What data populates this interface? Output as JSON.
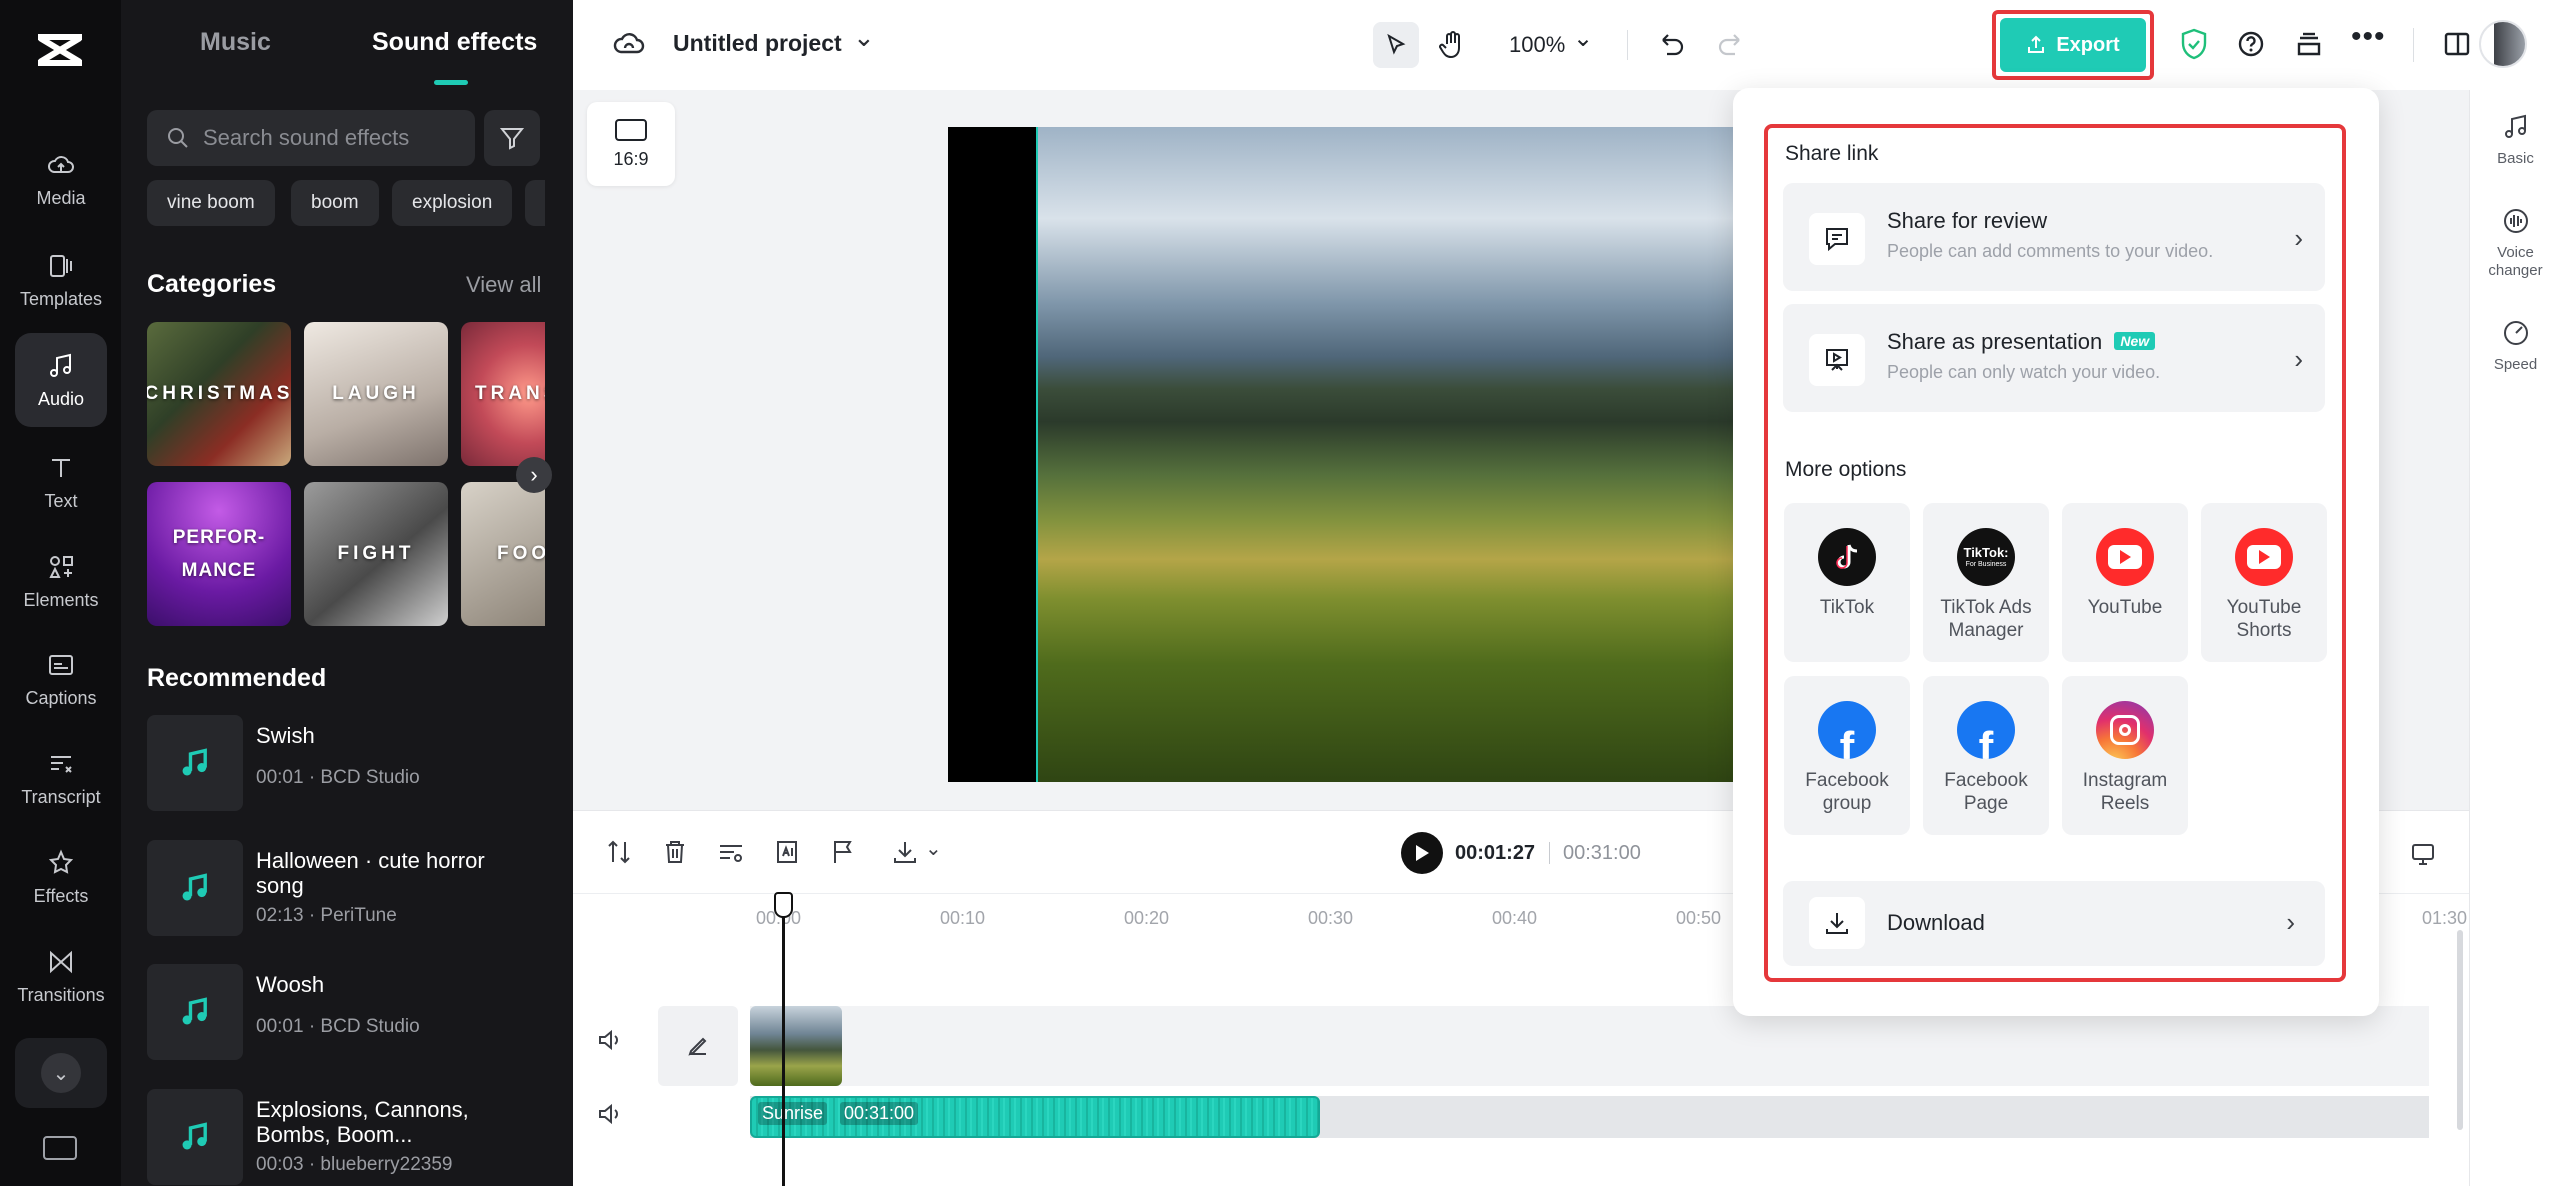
{
  "rail": {
    "items": [
      {
        "label": "Media",
        "icon": "cloud-icon"
      },
      {
        "label": "Templates",
        "icon": "templates-icon"
      },
      {
        "label": "Audio",
        "icon": "music-note-icon"
      },
      {
        "label": "Text",
        "icon": "text-icon"
      },
      {
        "label": "Elements",
        "icon": "elements-icon"
      },
      {
        "label": "Captions",
        "icon": "captions-icon"
      },
      {
        "label": "Transcript",
        "icon": "transcript-icon"
      },
      {
        "label": "Effects",
        "icon": "effects-icon"
      },
      {
        "label": "Transitions",
        "icon": "transitions-icon"
      }
    ]
  },
  "panel": {
    "tabs": [
      "Music",
      "Sound effects"
    ],
    "search_placeholder": "Search sound effects",
    "chips": [
      "vine boom",
      "boom",
      "explosion"
    ],
    "categories_title": "Categories",
    "view_all": "View all",
    "categories": [
      "CHRISTMAS",
      "LAUGH",
      "TRANSI",
      "PERFOR-\nMANCE",
      "FIGHT",
      "FOO"
    ],
    "recommended_title": "Recommended",
    "recommended": [
      {
        "title": "Swish",
        "meta": "00:01 · BCD Studio"
      },
      {
        "title": "Halloween · cute horror song",
        "meta": "02:13 · PeriTune"
      },
      {
        "title": "Woosh",
        "meta": "00:01 · BCD Studio"
      },
      {
        "title": "Explosions, Cannons, Bombs, Boom...",
        "meta": "00:03 · blueberry22359"
      }
    ]
  },
  "topbar": {
    "project_name": "Untitled project",
    "zoom": "100%",
    "export_label": "Export"
  },
  "stage": {
    "aspect": "16:9"
  },
  "popup": {
    "share_link_title": "Share link",
    "share_review": {
      "title": "Share for review",
      "subtitle": "People can add comments to your video."
    },
    "share_presentation": {
      "title": "Share as presentation",
      "badge": "New",
      "subtitle": "People can only watch your video."
    },
    "more_options_title": "More options",
    "options": [
      {
        "label": "TikTok",
        "icon": "tiktok-icon"
      },
      {
        "label": "TikTok Ads Manager",
        "icon": "tiktok-business-icon"
      },
      {
        "label": "YouTube",
        "icon": "youtube-icon"
      },
      {
        "label": "YouTube Shorts",
        "icon": "youtube-icon"
      },
      {
        "label": "Facebook group",
        "icon": "facebook-icon"
      },
      {
        "label": "Facebook Page",
        "icon": "facebook-icon"
      },
      {
        "label": "Instagram Reels",
        "icon": "instagram-icon"
      }
    ],
    "tiktok_business_text": "TikTok:",
    "tiktok_business_sub": "For Business",
    "download_label": "Download"
  },
  "player": {
    "current_time": "00:01:27",
    "total_time": "00:31:00"
  },
  "timeline": {
    "ruler": [
      "00:00",
      "00:10",
      "00:20",
      "00:30",
      "00:40",
      "00:50",
      "01:30"
    ],
    "audio_clip_name": "Sunrise",
    "audio_clip_duration": "00:31:00"
  },
  "right_tools": [
    {
      "label": "Basic",
      "icon": "music-note-icon"
    },
    {
      "label": "Voice changer",
      "icon": "voice-changer-icon"
    },
    {
      "label": "Speed",
      "icon": "speed-icon"
    }
  ],
  "colors": {
    "accent": "#1fcbb5",
    "highlight_red": "#e5383b",
    "rail_bg": "#0d0d0f",
    "panel_bg": "#17171a"
  }
}
